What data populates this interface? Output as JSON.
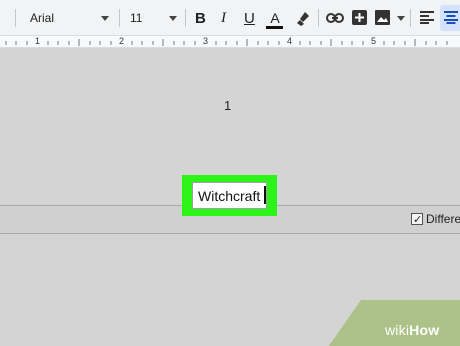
{
  "toolbar": {
    "font": "Arial",
    "font_size": "11",
    "bold_label": "B",
    "italic_label": "I",
    "underline_label": "U",
    "text_color_label": "A",
    "icons": [
      "highlighter-icon",
      "link-icon",
      "insert-comment-icon",
      "insert-image-icon",
      "align-left-icon",
      "align-center-icon"
    ]
  },
  "ruler": {
    "labels": [
      "1",
      "2",
      "3",
      "4",
      "5"
    ]
  },
  "document": {
    "page_number": "1",
    "footer_field_value": "Witchcraft",
    "different_first_page_label": "Differen",
    "different_first_page_checked": true
  },
  "watermark": {
    "wiki": "wiki",
    "how": "How"
  },
  "colors": {
    "highlight": "#2cf318",
    "toolbar_bg": "#f1f3f4",
    "page_bg": "#d4d4d4"
  }
}
